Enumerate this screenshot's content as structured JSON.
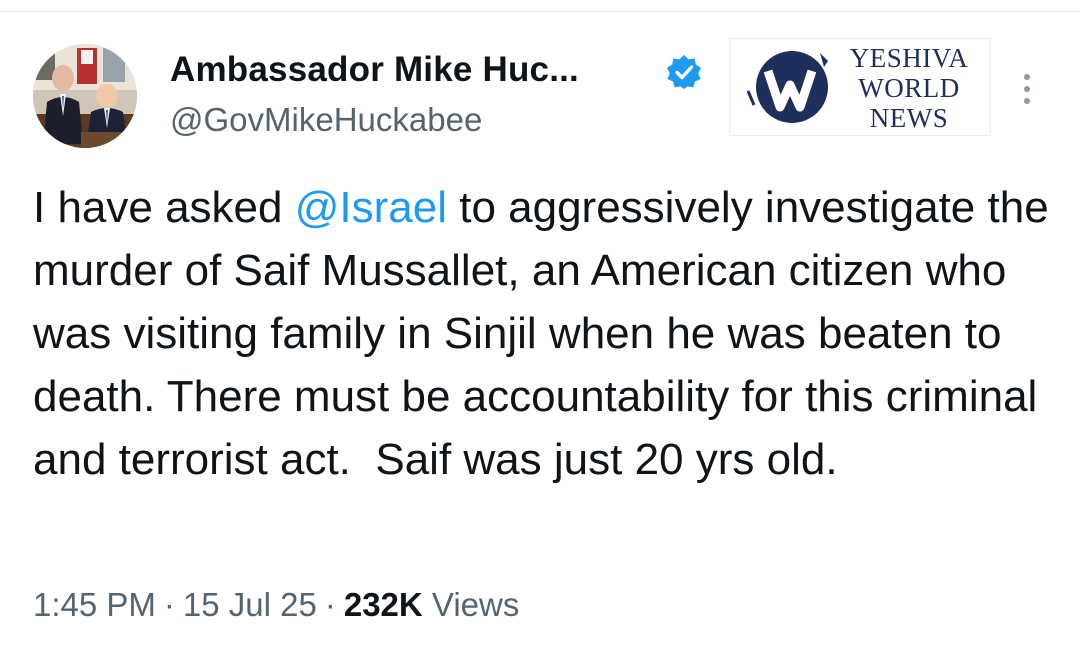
{
  "author": {
    "display_name": "Ambassador Mike Huc...",
    "handle": "@GovMikeHuckabee",
    "verified": true,
    "avatar": "profile-photo"
  },
  "logo": {
    "line1": "YESHIVA",
    "line2": "WORLD",
    "line3": "NEWS",
    "color": "#1f2f5c"
  },
  "tweet": {
    "text_before": "I have asked ",
    "mention": "@Israel",
    "text_after": " to aggressively investigate the murder of Saif Mussallet, an American citizen who was visiting family in Sinjil when he was beaten to death. There must be accountability for this criminal and terrorist act.  Saif was just 20 yrs old."
  },
  "meta": {
    "time": "1:45 PM",
    "separator": "·",
    "date": "15 Jul 25",
    "views_count": "232K",
    "views_label": "Views"
  },
  "colors": {
    "text": "#0f1419",
    "secondary": "#536471",
    "accent": "#1d9bf0"
  },
  "icons": {
    "verified": "verified-badge-icon",
    "more": "more-vertical-icon"
  }
}
